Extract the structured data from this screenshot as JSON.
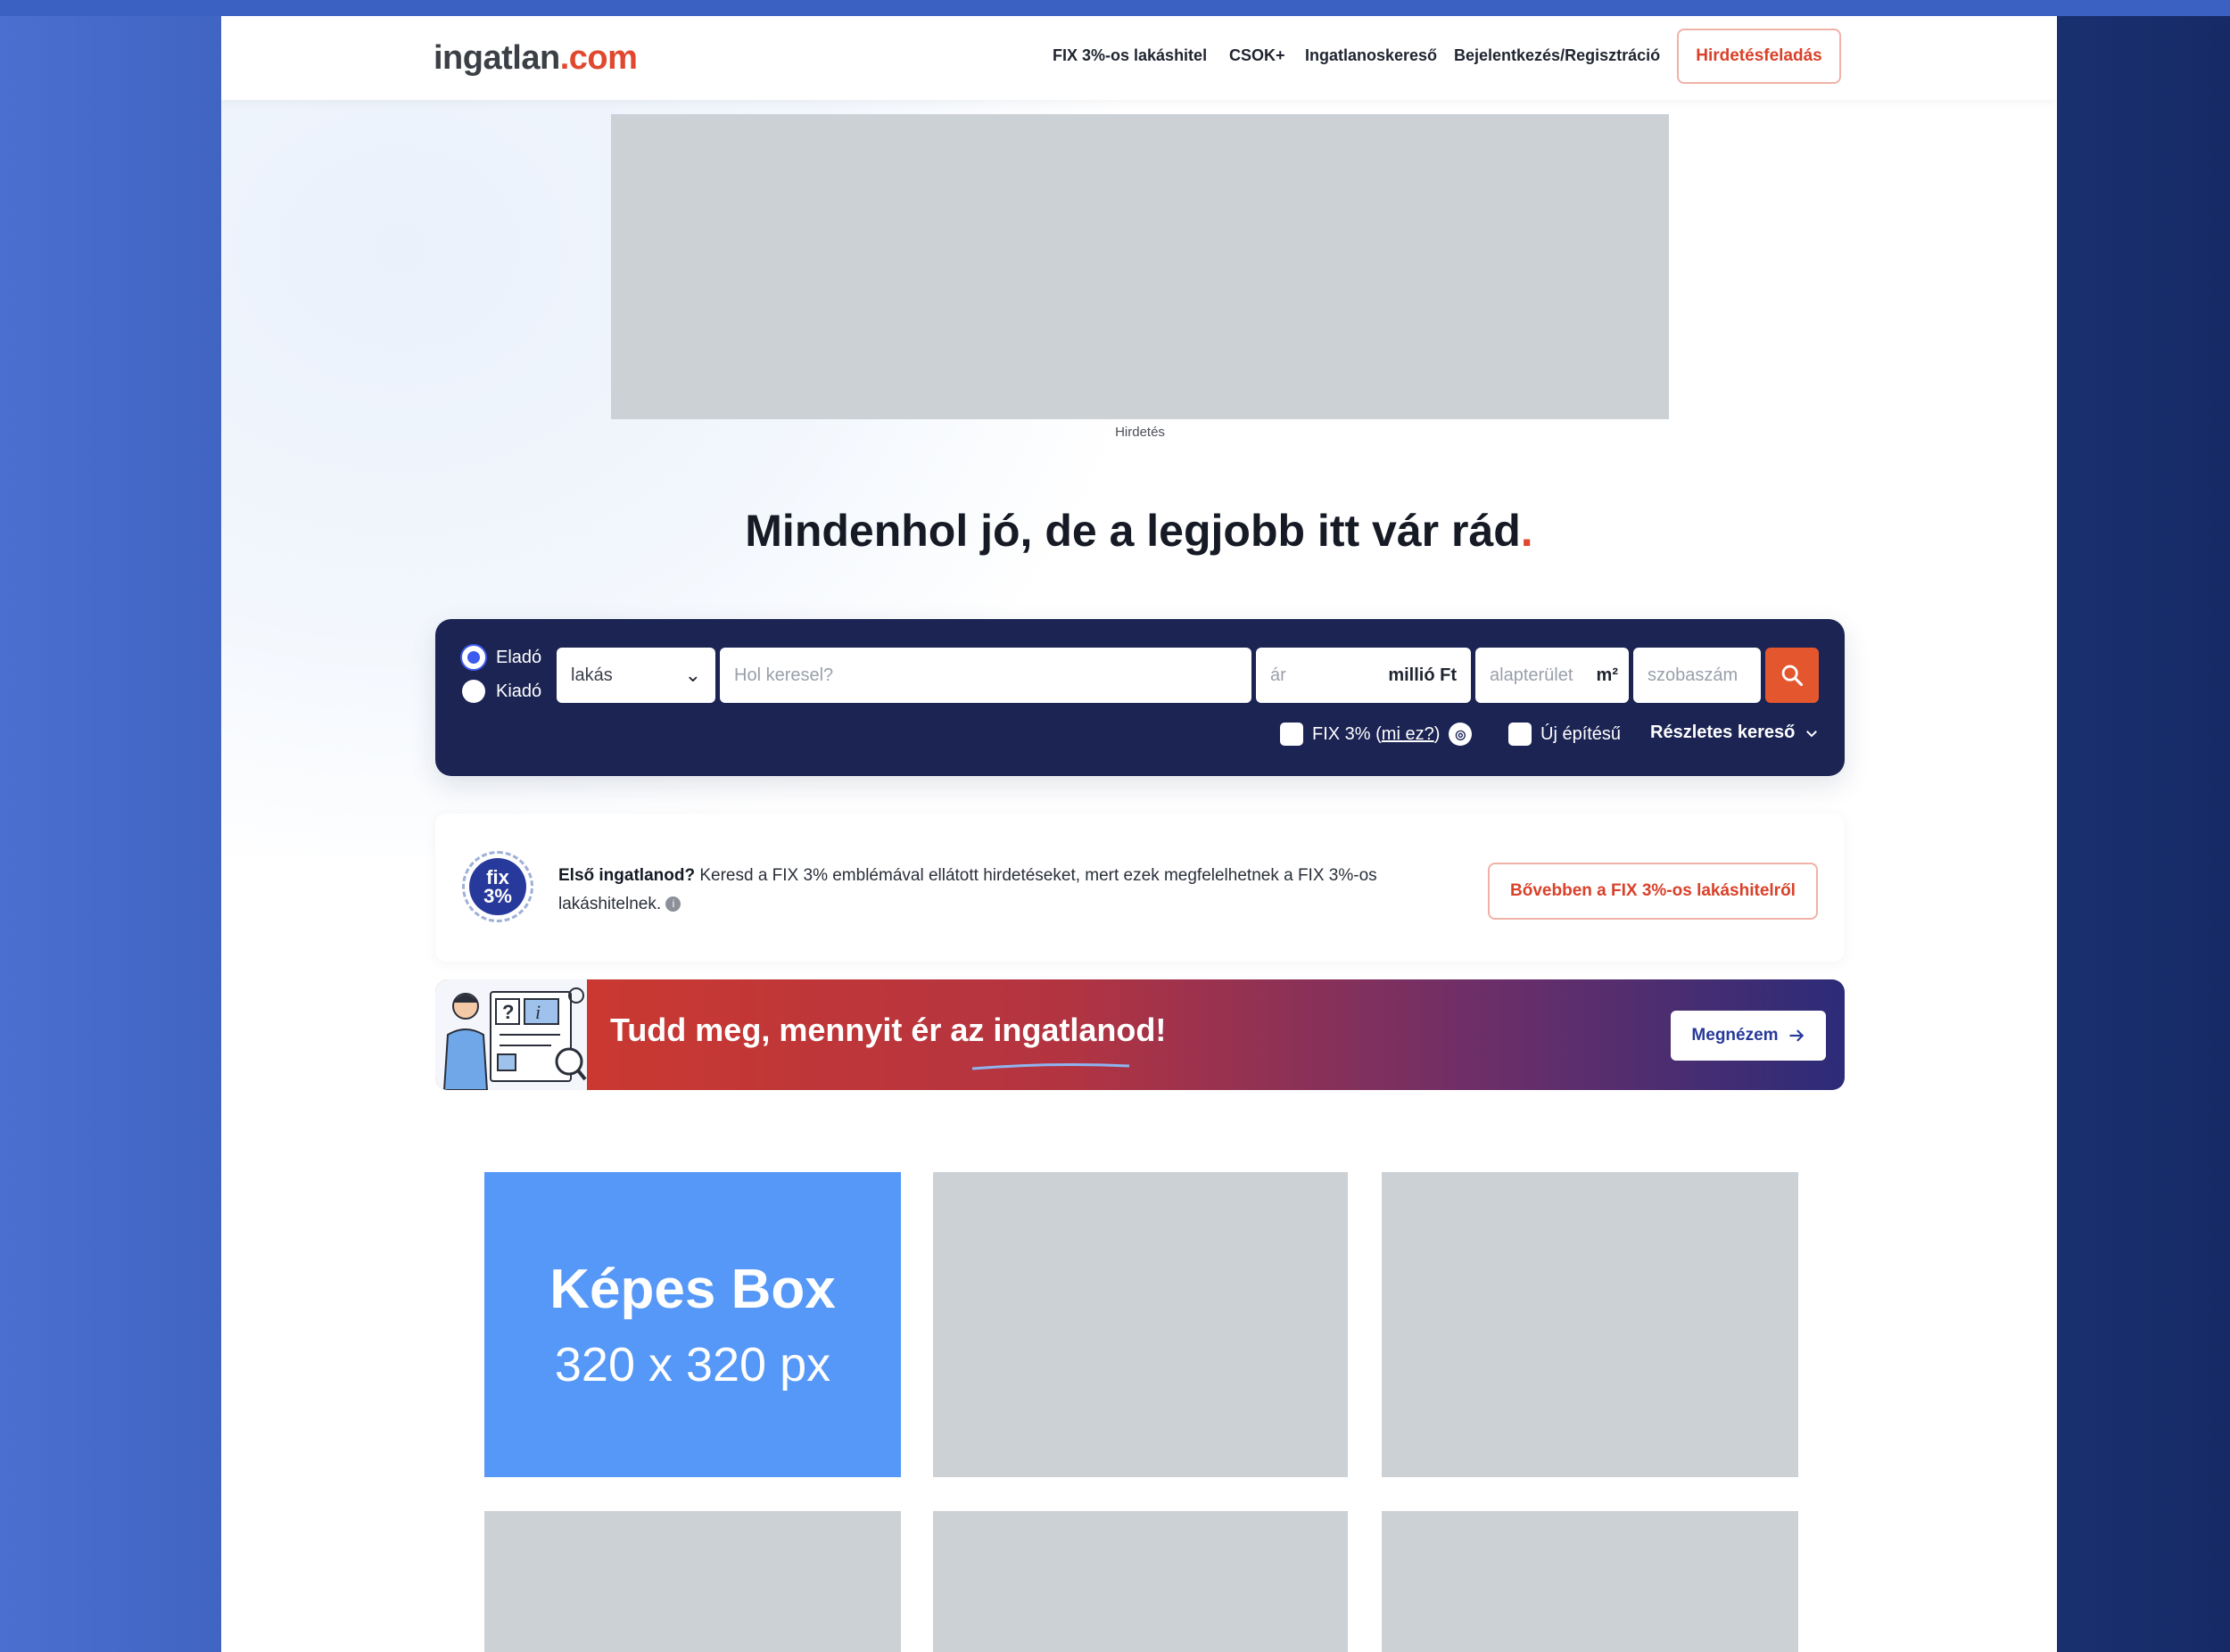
{
  "header": {
    "logo_part1": "ingatlan",
    "logo_part2": ".com",
    "nav": [
      "FIX 3%-os lakáshitel",
      "CSOK+",
      "Ingatlanoskereső",
      "Bejelentkezés/Regisztráció"
    ],
    "post_button": "Hirdetésfeladás"
  },
  "ad": {
    "label": "Hirdetés"
  },
  "hero": {
    "headline": "Mindenhol jó, de a legjobb itt vár rád",
    "headline_dot": "."
  },
  "search": {
    "radio_sale": "Eladó",
    "radio_rent": "Kiadó",
    "type_value": "lakás",
    "location_placeholder": "Hol keresel?",
    "price_placeholder": "ár",
    "price_unit": "millió Ft",
    "area_placeholder": "alapterület",
    "area_unit": "m²",
    "rooms_placeholder": "szobaszám",
    "fix_label": "FIX 3% (",
    "fix_link": "mi ez?",
    "fix_close": ")",
    "new_build_label": "Új építésű",
    "detailed_search": "Részletes kereső"
  },
  "info": {
    "badge_line1": "fix",
    "badge_line2": "3%",
    "bold": "Első ingatlanod?",
    "text": " Keresd a FIX 3% emblémával ellátott hirdetéseket, mert ezek megfelelhetnek a FIX 3%-os lakáshitelnek.",
    "button": "Bővebben a FIX 3%-os lakáshitelről"
  },
  "banner": {
    "title": "Tudd meg, mennyit ér az ingatlanod!",
    "button": "Megnézem"
  },
  "tiles": {
    "feature_title": "Képes Box",
    "feature_size": "320 x 320 px"
  },
  "colors": {
    "brand_red": "#e0492f",
    "navy": "#1b2453",
    "tile_blue": "#5698f7",
    "placeholder_gray": "#ccd1d6"
  }
}
